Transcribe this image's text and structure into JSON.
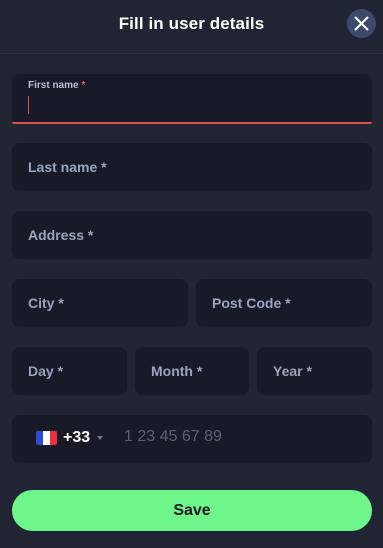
{
  "header": {
    "title": "Fill in user details",
    "close_icon": "close-icon"
  },
  "form": {
    "first_name": {
      "label": "First name",
      "required_mark": "*",
      "value": ""
    },
    "last_name": {
      "label": "Last name",
      "required_mark": "*"
    },
    "address": {
      "label": "Address",
      "required_mark": "*"
    },
    "city": {
      "label": "City",
      "required_mark": "*"
    },
    "post_code": {
      "label": "Post Code",
      "required_mark": "*"
    },
    "day": {
      "label": "Day",
      "required_mark": "*"
    },
    "month": {
      "label": "Month",
      "required_mark": "*"
    },
    "year": {
      "label": "Year",
      "required_mark": "*"
    },
    "phone": {
      "flag_icon": "france-flag-icon",
      "country_code": "+33",
      "dropdown_icon": "chevron-down-icon",
      "placeholder": "1 23 45 67 89"
    }
  },
  "save_label": "Save",
  "colors": {
    "background": "#212433",
    "field_bg": "#181b27",
    "accent_error": "#e0514c",
    "save_button": "#6ef68a",
    "close_button": "#3e4a6b",
    "flag_blue": "#2d4ad6",
    "flag_white": "#ffffff",
    "flag_red": "#e8313a"
  }
}
